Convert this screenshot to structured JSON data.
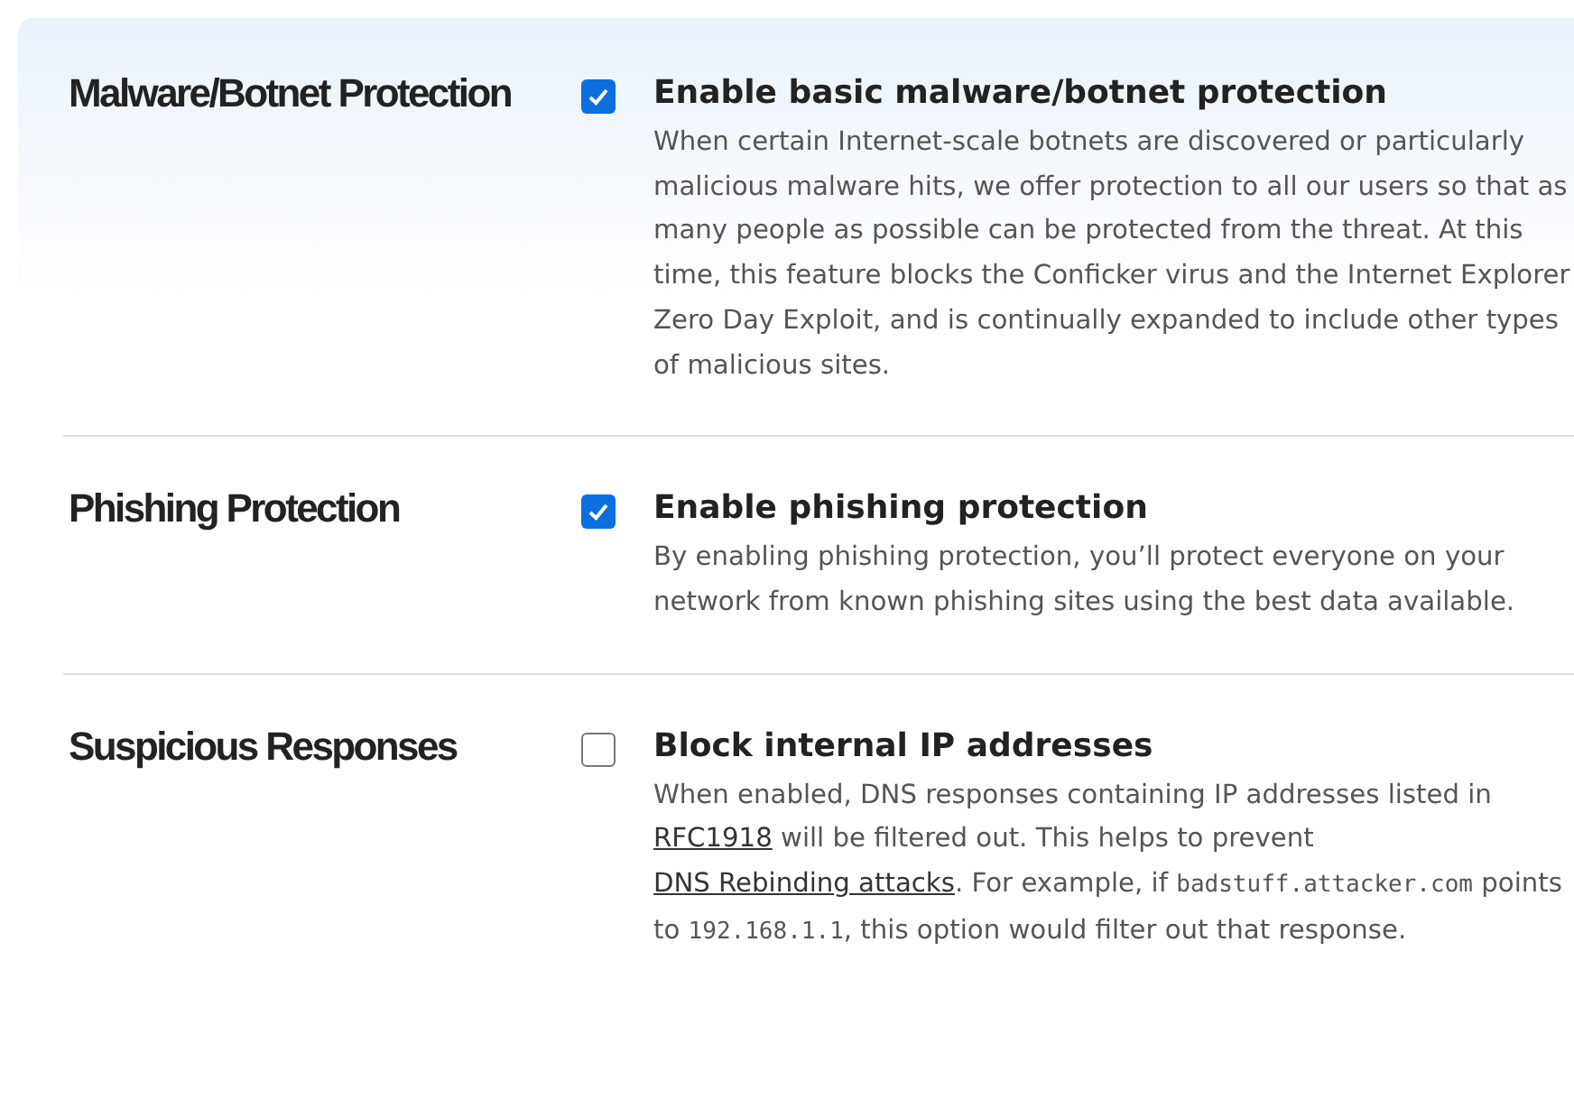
{
  "settings": [
    {
      "section": "Malware/Botnet Protection",
      "checked": true,
      "option": "Enable basic malware/botnet protection",
      "description": [
        {
          "kind": "text",
          "text": "When certain Internet-scale botnets are discovered or particularly malicious malware hits, we offer protection to all our users so that as many people as possible can be protected from the threat. At this time, this feature blocks the Conficker virus and the Internet Explorer Zero Day Exploit, and is continually expanded to include other types of malicious sites."
        }
      ]
    },
    {
      "section": "Phishing Protection",
      "checked": true,
      "option": "Enable phishing protection",
      "description": [
        {
          "kind": "text",
          "text": "By enabling phishing protection, you’ll protect everyone on your network from known phishing sites using the best data available."
        }
      ]
    },
    {
      "section": "Suspicious Responses",
      "checked": false,
      "option": "Block internal IP addresses",
      "description": [
        {
          "kind": "text",
          "text": "When enabled, DNS responses containing IP addresses listed in "
        },
        {
          "kind": "link",
          "text": "RFC1918"
        },
        {
          "kind": "text",
          "text": " will be filtered out. This helps to prevent "
        },
        {
          "kind": "link",
          "text": "DNS Rebinding attacks"
        },
        {
          "kind": "text",
          "text": ". For example, if "
        },
        {
          "kind": "code",
          "text": "badstuff.attacker.com"
        },
        {
          "kind": "text",
          "text": " points to "
        },
        {
          "kind": "code",
          "text": "192.168.1.1"
        },
        {
          "kind": "text",
          "text": ", this option would filter out that response."
        }
      ]
    }
  ]
}
